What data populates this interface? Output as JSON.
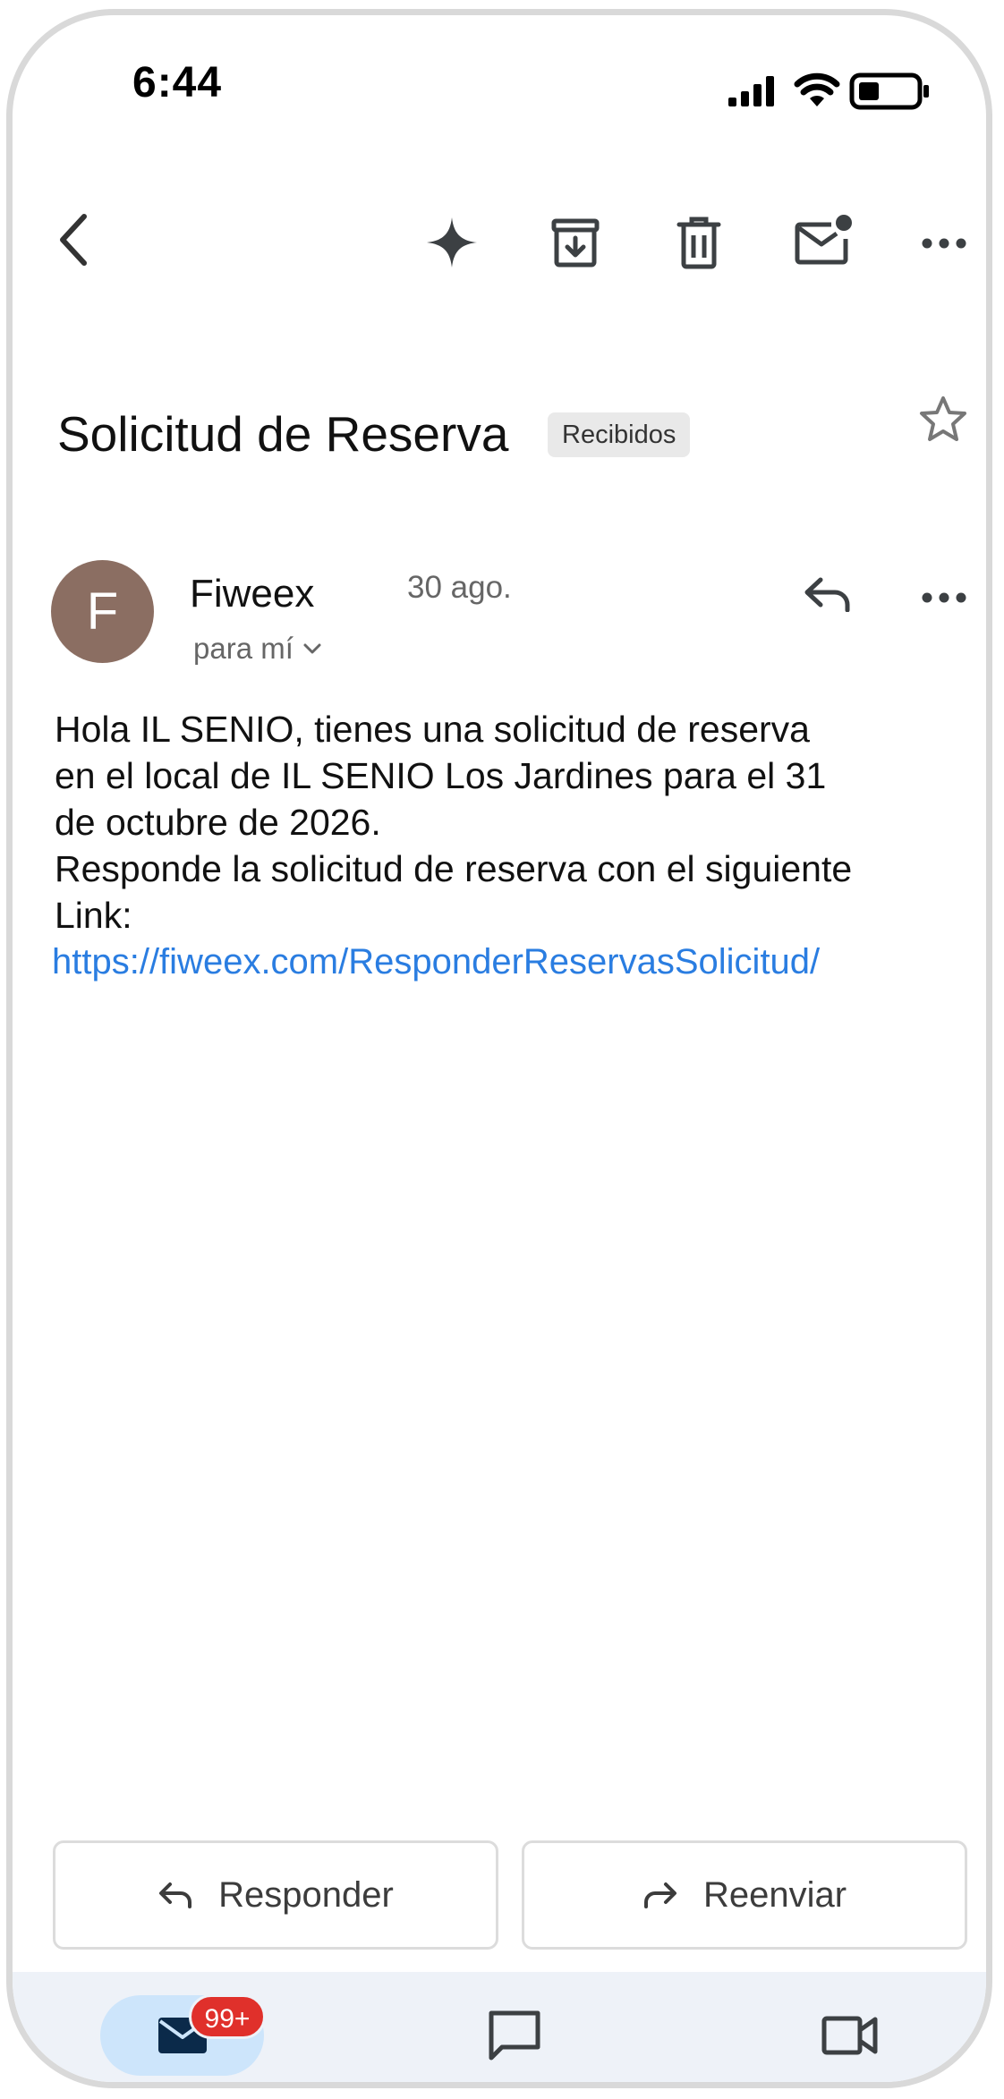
{
  "status_bar": {
    "time": "6:44"
  },
  "toolbar": {
    "icons": [
      "back-icon",
      "sparkle-icon",
      "archive-icon",
      "delete-icon",
      "mark-unread-icon",
      "more-icon"
    ]
  },
  "email": {
    "subject": "Solicitud de Reserva",
    "label": "Recibidos",
    "sender_initial": "F",
    "sender_name": "Fiweex",
    "date": "30 ago.",
    "recipient": "para mí",
    "body_lines": [
      "Hola IL SENIO, tienes una solicitud de reserva",
      "en el local de IL SENIO Los Jardines para el 31",
      "de octubre de 2026.",
      "Responde la solicitud de reserva con el siguiente",
      "Link:"
    ],
    "link": "https://fiweex.com/ResponderReservasSolicitud/"
  },
  "actions": {
    "reply_label": "Responder",
    "forward_label": "Reenviar"
  },
  "bottom_nav": {
    "mail_badge": "99+"
  },
  "colors": {
    "avatar": "#8b6e62",
    "link": "#2a7de1",
    "badge": "#e0302b",
    "nav_active": "#cde5fb",
    "nav_bar": "#eef2f8"
  }
}
